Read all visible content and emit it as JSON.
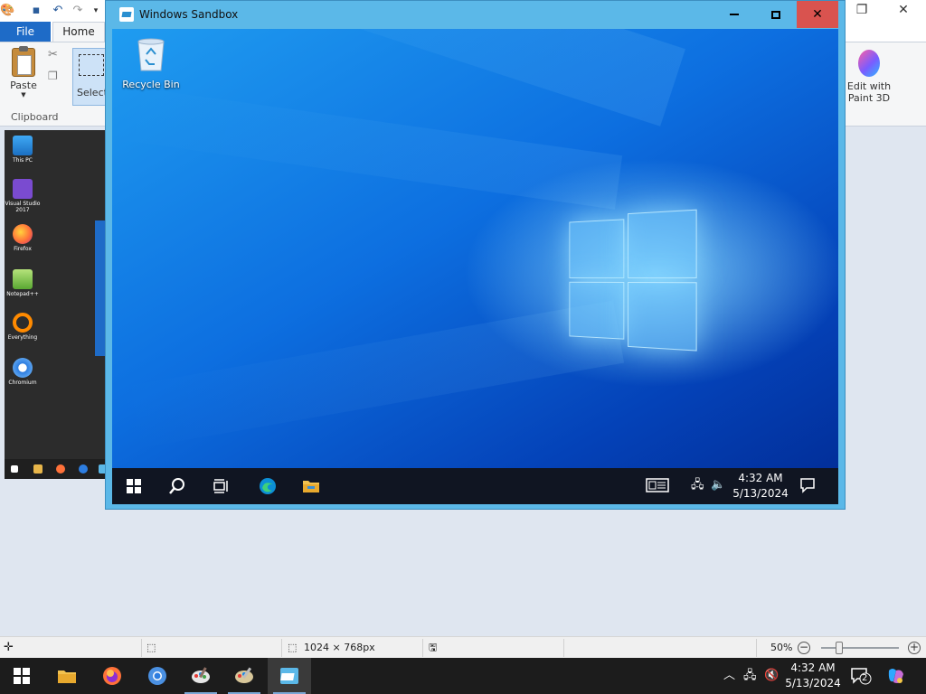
{
  "paint": {
    "tabs": {
      "file": "File",
      "home": "Home"
    },
    "ribbon": {
      "paste": "Paste",
      "select": "Select",
      "clipboard_group": "Clipboard",
      "edit_paint3d": "Edit with Paint 3D"
    },
    "canvas_preview": {
      "icons": [
        "This PC",
        "Visual Studio 2017",
        "Firefox",
        "Notepad++",
        "Everything",
        "Chromium"
      ]
    },
    "statusbar": {
      "dimensions": "1024 × 768px",
      "zoom": "50%"
    }
  },
  "sandbox": {
    "title": "Windows Sandbox",
    "desktop": {
      "recycle_bin": "Recycle Bin"
    },
    "taskbar": {
      "time": "4:32 AM",
      "date": "5/13/2024"
    }
  },
  "host_taskbar": {
    "time": "4:32 AM",
    "date": "5/13/2024",
    "notification_count": "2"
  },
  "colors": {
    "file_tab": "#1e6bc7",
    "sandbox_frame": "#5bb8e8",
    "close_button": "#d9534f",
    "taskbar": "#1c1c1c"
  }
}
